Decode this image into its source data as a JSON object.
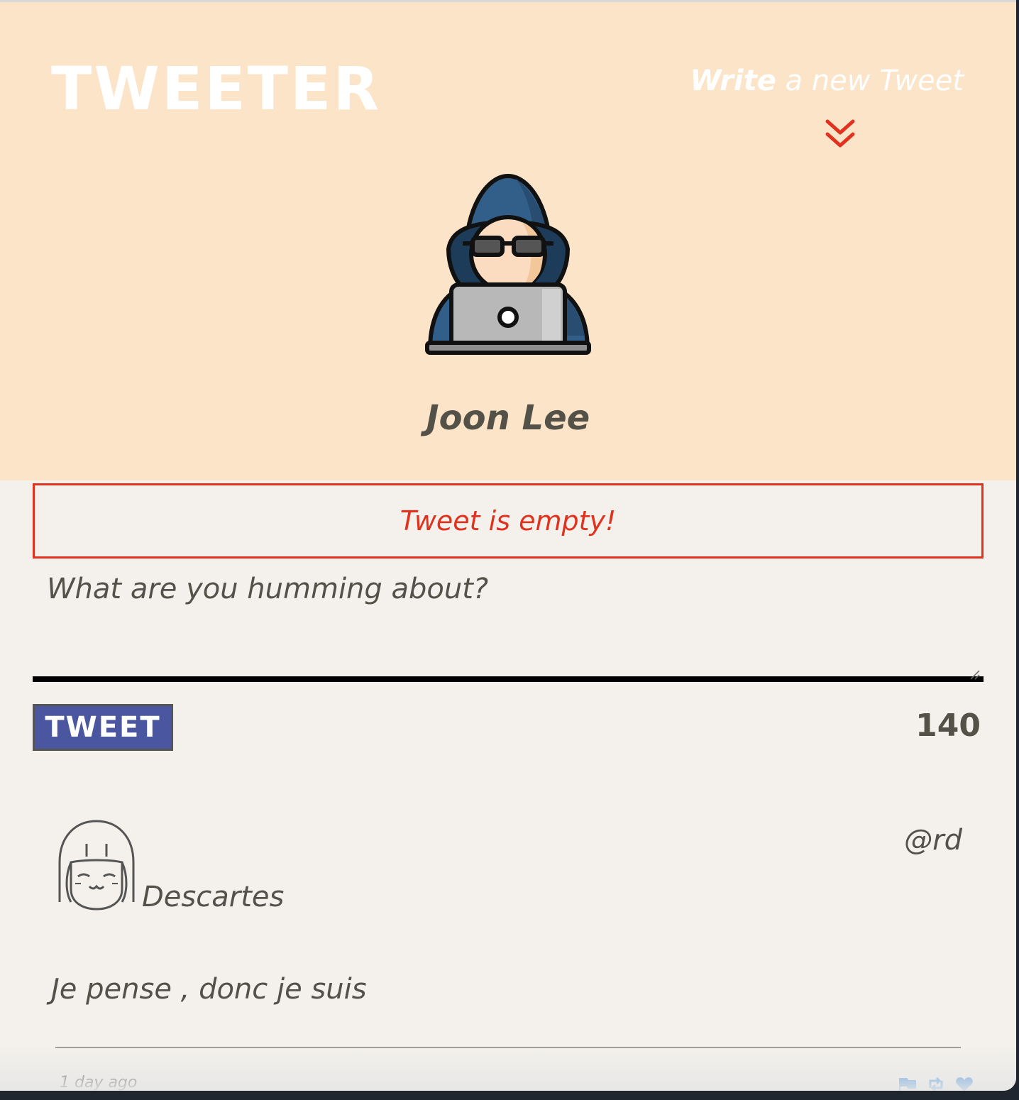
{
  "header": {
    "logo": "TWEETER",
    "compose_bold": "Write",
    "compose_rest": " a new Tweet",
    "profile_name": "Joon Lee"
  },
  "composer": {
    "error": "Tweet is empty!",
    "placeholder": "What are you humming about?",
    "submit_label": "TWEET",
    "counter": "140"
  },
  "tweets": [
    {
      "name": "Descartes",
      "handle": "@rd",
      "body": "Je pense , donc je suis",
      "time": "1 day ago",
      "actions": [
        "flag-icon",
        "retweet-icon",
        "heart-icon"
      ]
    }
  ],
  "colors": {
    "header_bg": "#fbe4c8",
    "accent_red": "#e0321f",
    "button_blue": "#4a57a0",
    "text": "#545149",
    "action_blue": "#3b8de0"
  }
}
